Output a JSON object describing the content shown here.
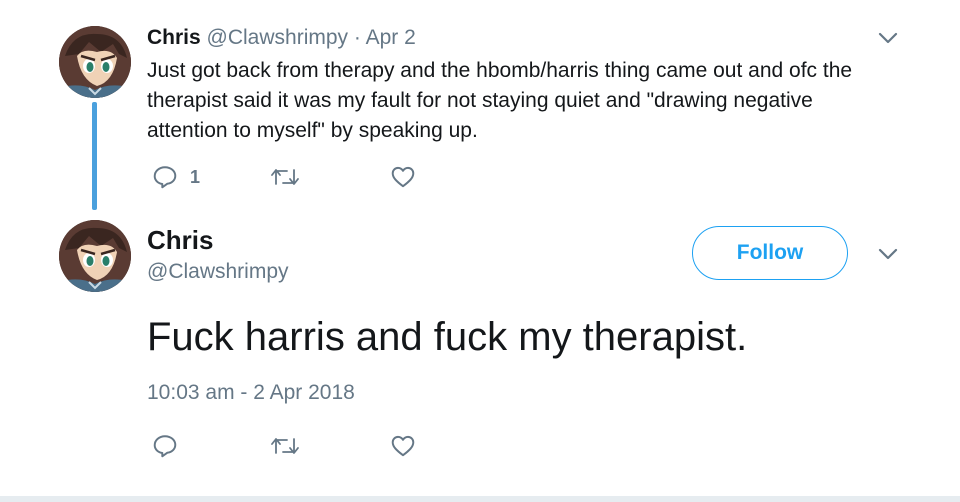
{
  "parent_tweet": {
    "display_name": "Chris",
    "handle": "@Clawshrimpy",
    "separator": "·",
    "date": "Apr 2",
    "text": "Just got back from therapy and the hbomb/harris thing came out and ofc the therapist said it was my fault for not staying quiet and \"drawing negative attention to myself\" by speaking up.",
    "reply_count": "1",
    "icons": [
      "reply-icon",
      "retweet-icon",
      "like-icon",
      "chevron-down-icon",
      "avatar"
    ]
  },
  "main_tweet": {
    "display_name": "Chris",
    "handle": "@Clawshrimpy",
    "follow_label": "Follow",
    "text": "Fuck harris and fuck my therapist.",
    "timestamp": "10:03 am - 2 Apr 2018",
    "icons": [
      "reply-icon",
      "retweet-icon",
      "like-icon",
      "chevron-down-icon",
      "avatar"
    ]
  },
  "colors": {
    "accent": "#1da1f2",
    "thread_line": "#4aa0dd",
    "secondary_text": "#657786",
    "primary_text": "#14171a",
    "icon_gray": "#657786"
  }
}
